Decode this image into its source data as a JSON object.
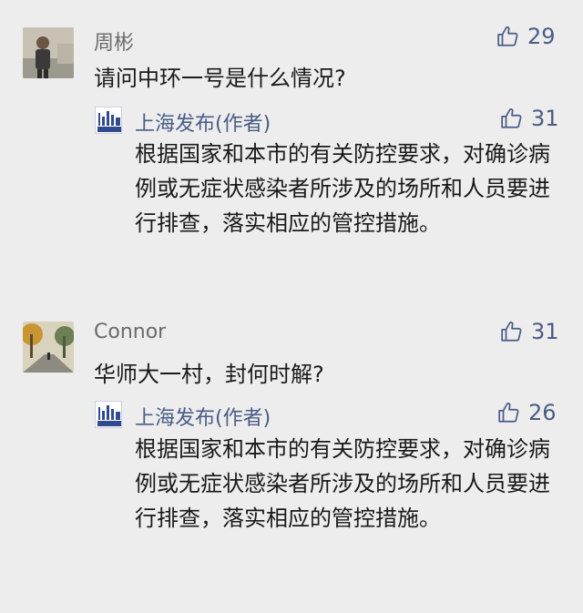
{
  "comments": [
    {
      "username": "周彬",
      "avatar_icon": "person-photo",
      "text": "请问中环一号是什么情况?",
      "likes": "29",
      "reply": {
        "author": "上海发布(作者)",
        "author_avatar_icon": "shanghai-fabu-logo",
        "text": "根据国家和本市的有关防控要求，对确诊病例或无症状感染者所涉及的场所和人员要进行排查，落实相应的管控措施。",
        "likes": "31"
      }
    },
    {
      "username": "Connor",
      "avatar_icon": "street-photo",
      "text": "华师大一村，封何时解?",
      "likes": "31",
      "reply": {
        "author": "上海发布(作者)",
        "author_avatar_icon": "shanghai-fabu-logo",
        "text": "根据国家和本市的有关防控要求，对确诊病例或无症状感染者所涉及的场所和人员要进行排查，落实相应的管控措施。",
        "likes": "26"
      }
    }
  ],
  "colors": {
    "background": "#ededed",
    "like": "#4a5c86",
    "username": "#6b6b6b",
    "text": "#1a1a1a"
  }
}
